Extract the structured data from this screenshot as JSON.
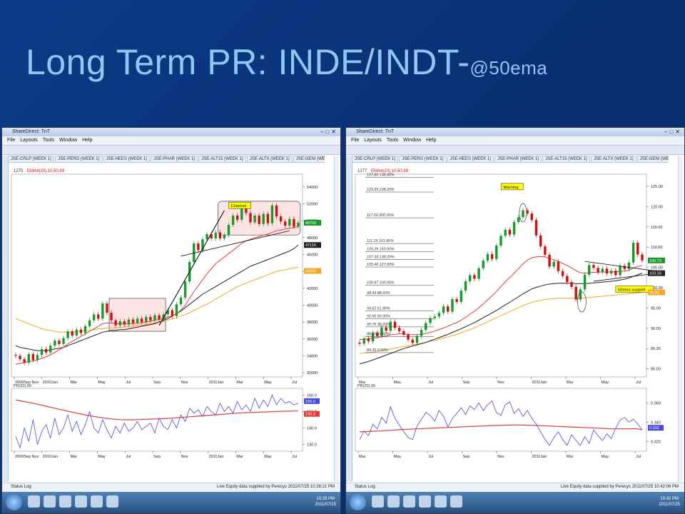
{
  "title": {
    "main": "Long Term PR: INDE/INDT-",
    "sub": "@50ema"
  },
  "left_window": {
    "window_title": "ShareDirect: TnT",
    "menu": [
      "File",
      "Layouts",
      "Tools",
      "Window",
      "Help"
    ],
    "tabs": [
      "JSE-CRLP (WEEK 1)",
      "JSE-PERG (WEEK 1)",
      "JSE-HEES (WEEK 1)",
      "JSE-PHAR (WEEK 1)",
      "JSE-ALT15 (WEEK 1)",
      "JSE-ALTX (WEEK 1)",
      "JSE-GENI (WEEK 1)",
      "JSE-ELEE (WEEK 1)",
      "JSE-INDE (WEEK 1)",
      "JSE-INDT (WEEK 1)",
      "JSE-SUPS (WEEK 1)",
      "JSE-"
    ],
    "active_tab": 8,
    "status_log": "Status Log",
    "live_text": "Live Equity data supplied by Peresys   2011/07/25 10:28:21 PM",
    "clock": "10:29 PM",
    "clock_date": "2011/07/25"
  },
  "right_window": {
    "window_title": "ShareDirect: TnT",
    "menu": [
      "File",
      "Layouts",
      "Tools",
      "Window",
      "Help"
    ],
    "tabs": [
      "JSE-CRLP (WEEK 1)",
      "JSE-PERG (WEEK 1)",
      "JSE-HEES (WEEK 1)",
      "JSE-PHAR (WEEK 1)",
      "JSE-ALT15 (WEEK 1)",
      "JSE-ALTX (WEEK 1)",
      "JSE-GENI (WEEK 1)",
      "JSE-ELEE (WEEK 1)",
      "JSE-INDE (WEEK 1)",
      "JSE-INDT (WEEK 1)",
      "JSE-SUPS (WEEK 1)",
      "JSE-"
    ],
    "active_tab": 9,
    "status_log": "Status Log",
    "live_text": "Live Equity data supplied by Peresys   2011/07/25 10:42:06 PM",
    "clock": "10:42 PM",
    "clock_date": "2011/07/25"
  },
  "colors": {
    "background": "#0a2f72",
    "title": "#8fc6f2",
    "bull": "#1a9a2a",
    "bear": "#d01010",
    "ema_green": "#2aa52a",
    "ema_red": "#e03a3a",
    "ema_black": "#222222",
    "ema_orange": "#f5a623",
    "pr_blue": "#4a4ad8",
    "pr_red": "#e03a3a",
    "box_fill": "#fde4e4",
    "label_yellow": "#ffff00"
  },
  "chart_data": [
    {
      "type": "candlestick",
      "instrument": "INDE",
      "header": "1275",
      "indicator_label": "EMA4(20),10,50,89",
      "y_ticks": [
        32000,
        34000,
        36000,
        38000,
        40000,
        42000,
        44000,
        46000,
        48000,
        50000,
        52000,
        54000
      ],
      "y_tick_labels": [
        "32000",
        "34000",
        "36000",
        "38000",
        "40000",
        "42000",
        "44000",
        "46000",
        "48000",
        "50000",
        "52000",
        "54000"
      ],
      "ylim": [
        31500,
        55500
      ],
      "x_labels": [
        "2009Sep Nov",
        "2010Jan",
        "Mar",
        "May",
        "Jul",
        "Sep",
        "Nov",
        "2011Jan",
        "Mar",
        "May",
        "Jul"
      ],
      "price_tags": [
        {
          "value": 49750,
          "text": "49750",
          "color": "#1a9a2a"
        },
        {
          "value": 47116,
          "text": "47116",
          "color": "#222222"
        },
        {
          "value": 44045,
          "text": "44045",
          "color": "#f5a623"
        }
      ],
      "annotations": [
        {
          "text": "Channel"
        }
      ],
      "close": [
        34000,
        33600,
        33200,
        34200,
        33500,
        34100,
        34800,
        34400,
        35200,
        35800,
        35400,
        36100,
        36900,
        36400,
        37100,
        36700,
        37500,
        38200,
        38900,
        38400,
        40200,
        39100,
        38200,
        37600,
        38100,
        37700,
        38300,
        37900,
        38400,
        38000,
        38600,
        38200,
        38800,
        38300,
        38900,
        39400,
        38700,
        40100,
        40900,
        42800,
        45100,
        47300,
        46500,
        47800,
        48400,
        47900,
        48600,
        47900,
        48300,
        49500,
        50600,
        50100,
        51400,
        50900,
        49800,
        50600,
        49600,
        50800,
        49700,
        51800,
        50500,
        49900,
        49400,
        50200,
        49300,
        49750
      ],
      "ema20": [
        33000,
        33100,
        33200,
        33300,
        33400,
        33500,
        33700,
        33900,
        34100,
        34400,
        34700,
        35000,
        35400,
        35700,
        36000,
        36300,
        36600,
        36900,
        37200,
        37500,
        37800,
        37900,
        37900,
        37800,
        37800,
        37800,
        37800,
        37800,
        37900,
        37900,
        38000,
        38100,
        38200,
        38300,
        38400,
        38600,
        38700,
        39000,
        39400,
        40000,
        40800,
        41600,
        42300,
        43000,
        43700,
        44300,
        44900,
        45300,
        45700,
        46100,
        46500,
        46900,
        47300,
        47600,
        47800,
        48000,
        48100,
        48300,
        48400,
        48600,
        48800,
        48900,
        49000,
        49100,
        49200,
        49300
      ],
      "ema89": [
        35200,
        35000,
        34900,
        34800,
        34700,
        34600,
        34600,
        34600,
        34700,
        34800,
        34900,
        35000,
        35200,
        35400,
        35600,
        35800,
        36000,
        36200,
        36400,
        36600,
        36800,
        36900,
        37000,
        37000,
        37100,
        37100,
        37200,
        37300,
        37400,
        37500,
        37600,
        37700,
        37800,
        38000,
        38200,
        38400,
        38700,
        39000,
        39300,
        39700,
        40100,
        40500,
        40900,
        41300,
        41600,
        41900,
        42200,
        42500,
        42800,
        43100,
        43400,
        43700,
        44000,
        44300,
        44600,
        44800,
        45000,
        45200,
        45400,
        45600,
        45800,
        46000,
        46200,
        46400,
        46700,
        47100
      ],
      "ema50": [
        38400,
        38200,
        38000,
        37800,
        37600,
        37400,
        37200,
        37100,
        37000,
        36900,
        36800,
        36800,
        36800,
        36800,
        36900,
        36900,
        37000,
        37000,
        37100,
        37200,
        37200,
        37300,
        37300,
        37300,
        37400,
        37400,
        37500,
        37500,
        37600,
        37600,
        37700,
        37800,
        37900,
        38000,
        38100,
        38200,
        38400,
        38500,
        38700,
        38900,
        39100,
        39400,
        39600,
        39900,
        40100,
        40400,
        40700,
        41000,
        41300,
        41600,
        41900,
        42200,
        42400,
        42600,
        42800,
        43000,
        43200,
        43400,
        43600,
        43800,
        44000,
        44100,
        44200,
        44300,
        44400,
        44500
      ],
      "pr_panel": {
        "label": "PR(20),89",
        "y_ticks": [
          130,
          140,
          150,
          160
        ],
        "y_tick_labels": [
          "130.0",
          "140.0",
          "150.0",
          "160.0"
        ],
        "ylim": [
          126,
          164
        ],
        "tags": [
          "155.0",
          "150.3"
        ],
        "pr": [
          135,
          128,
          140,
          132,
          145,
          130,
          138,
          142,
          134,
          146,
          136,
          140,
          148,
          138,
          144,
          136,
          142,
          150,
          140,
          137,
          145,
          139,
          134,
          141,
          137,
          143,
          138,
          140,
          144,
          139,
          141,
          143,
          137,
          146,
          141,
          139,
          145,
          140,
          148,
          144,
          152,
          149,
          151,
          147,
          153,
          150,
          148,
          155,
          150,
          153,
          149,
          156,
          151,
          154,
          150,
          158,
          152,
          157,
          153,
          160,
          154,
          158,
          155,
          156,
          154,
          155
        ],
        "signal": [
          157,
          156.5,
          156,
          155.5,
          155,
          154.4,
          153.8,
          153.2,
          152.6,
          152,
          151.4,
          150.8,
          150.2,
          149.6,
          149,
          148.5,
          148,
          147.5,
          147,
          146.6,
          146.2,
          145.8,
          145.5,
          145.3,
          145.1,
          145,
          145,
          145,
          145.1,
          145.2,
          145.3,
          145.4,
          145.5,
          145.6,
          145.7,
          145.8,
          146,
          146.2,
          146.4,
          146.6,
          146.8,
          147,
          147.2,
          147.4,
          147.6,
          147.8,
          148,
          148.2,
          148.4,
          148.6,
          148.8,
          149,
          149.2,
          149.3,
          149.4,
          149.5,
          149.6,
          149.7,
          149.8,
          149.9,
          150,
          150.1,
          150.2,
          150.2,
          150.3,
          150.3
        ]
      }
    },
    {
      "type": "candlestick",
      "instrument": "INDT",
      "header": "1277",
      "indicator_label": "EMA4(20),10,50,89",
      "y_ticks": [
        80,
        85,
        90,
        95,
        100,
        105,
        110,
        115,
        120,
        125
      ],
      "y_tick_labels": [
        "80.00",
        "85.00",
        "90.00",
        "95.00",
        "100.00",
        "105.00",
        "110.00",
        "115.00",
        "120.00",
        "125.00"
      ],
      "ylim": [
        78,
        128
      ],
      "x_labels": [
        "Mar",
        "May",
        "Jul",
        "Sep",
        "Nov",
        "2011Jan",
        "Mar",
        "May",
        "Jul"
      ],
      "price_tags": [
        {
          "value": 106.73,
          "text": "106.73",
          "color": "#1a9a2a"
        },
        {
          "value": 103.59,
          "text": "103.59",
          "color": "#222222"
        },
        {
          "value": 98.85,
          "text": "98.85",
          "color": "#f5a623"
        }
      ],
      "fib_levels": [
        "127.60 138.40%",
        "123.95 238.20%",
        "117.60 200.00%",
        "111.25 161.80%",
        "109.29 150.00%",
        "107.33 138.20%",
        "105.46 127.00%",
        "100.97 100.00%",
        "98.43 88.60%",
        "94.62 61.80%",
        "92.66 50.00%",
        "90.70 38.20%",
        "88.27 23.60%",
        "84.35 0.00%"
      ],
      "annotations": [
        {
          "text": "Warning"
        },
        {
          "text": "50ema support"
        }
      ],
      "close": [
        86.2,
        87.5,
        86.8,
        88.9,
        88.1,
        90.2,
        89.4,
        91.6,
        90.1,
        89.3,
        88.4,
        87.2,
        86.4,
        88.1,
        89.6,
        91.3,
        92.5,
        92.9,
        93.8,
        95.4,
        94.1,
        97.2,
        96.5,
        99.3,
        101.6,
        103.1,
        102.2,
        104.8,
        106.7,
        108.3,
        107.1,
        110.4,
        112.8,
        114.3,
        113.1,
        116.2,
        117.4,
        119.1,
        118.3,
        116.7,
        112.9,
        110.2,
        108.1,
        105.2,
        106.4,
        104.1,
        102.9,
        101.4,
        100.2,
        97.1,
        99.6,
        103.2,
        105.6,
        104.9,
        103.8,
        104.7,
        103.5,
        104.2,
        103.1,
        105.4,
        104.6,
        106.2,
        111.1,
        108.2,
        106.73
      ],
      "ema20": [
        87.2,
        87.3,
        87.4,
        87.6,
        87.7,
        87.9,
        88.1,
        88.4,
        88.5,
        88.6,
        88.6,
        88.5,
        88.4,
        88.4,
        88.5,
        88.7,
        89,
        89.3,
        89.7,
        90.1,
        90.5,
        91,
        91.4,
        92,
        92.7,
        93.5,
        94.2,
        95.1,
        96,
        97,
        98,
        99.1,
        100.3,
        101.5,
        102.5,
        103.6,
        104.7,
        105.9,
        106.8,
        107.4,
        107.6,
        107.7,
        107.6,
        107.2,
        106.9,
        106.5,
        106,
        105.5,
        104.9,
        104.2,
        103.7,
        103.6,
        103.7,
        103.8,
        103.8,
        103.9,
        103.9,
        103.9,
        103.9,
        104,
        104.1,
        104.3,
        104.9,
        105.2,
        105.5
      ],
      "ema89": [
        81.2,
        81.5,
        81.8,
        82.2,
        82.6,
        83,
        83.4,
        83.8,
        84.2,
        84.6,
        85,
        85.3,
        85.6,
        85.9,
        86.2,
        86.5,
        86.9,
        87.3,
        87.7,
        88.1,
        88.5,
        89,
        89.4,
        89.9,
        90.4,
        90.9,
        91.4,
        92,
        92.6,
        93.2,
        93.8,
        94.4,
        95.1,
        95.8,
        96.4,
        97.1,
        97.8,
        98.5,
        99.1,
        99.7,
        100.1,
        100.4,
        100.7,
        100.9,
        101,
        101.1,
        101.1,
        101.1,
        101.1,
        101,
        101,
        101,
        101.1,
        101.2,
        101.3,
        101.4,
        101.5,
        101.6,
        101.7,
        101.9,
        102.1,
        102.4,
        102.8,
        103.2,
        103.59
      ],
      "ema50": [
        83.8,
        83.9,
        84,
        84.1,
        84.3,
        84.5,
        84.7,
        84.9,
        85.1,
        85.3,
        85.5,
        85.7,
        85.9,
        86.1,
        86.3,
        86.5,
        86.8,
        87,
        87.3,
        87.6,
        87.9,
        88.2,
        88.5,
        88.9,
        89.3,
        89.7,
        90.1,
        90.6,
        91.1,
        91.6,
        92.1,
        92.6,
        93.1,
        93.6,
        94.1,
        94.6,
        95.1,
        95.6,
        96,
        96.4,
        96.7,
        96.9,
        97.1,
        97.2,
        97.3,
        97.4,
        97.4,
        97.4,
        97.4,
        97.4,
        97.4,
        97.5,
        97.6,
        97.7,
        97.8,
        97.9,
        98,
        98.1,
        98.2,
        98.3,
        98.4,
        98.5,
        98.6,
        98.7,
        98.85
      ],
      "pr_panel": {
        "label": "PR(20),89",
        "y_ticks": [
          0.32,
          0.34,
          0.36
        ],
        "y_tick_labels": [
          "0.320",
          "0.340",
          "0.360"
        ],
        "ylim": [
          0.31,
          0.375
        ],
        "tags": [
          "0.332"
        ],
        "pr": [
          0.322,
          0.331,
          0.326,
          0.338,
          0.333,
          0.345,
          0.339,
          0.356,
          0.344,
          0.337,
          0.33,
          0.324,
          0.322,
          0.336,
          0.343,
          0.35,
          0.347,
          0.341,
          0.352,
          0.346,
          0.335,
          0.344,
          0.349,
          0.355,
          0.348,
          0.357,
          0.353,
          0.36,
          0.352,
          0.358,
          0.362,
          0.35,
          0.347,
          0.358,
          0.361,
          0.349,
          0.354,
          0.346,
          0.352,
          0.344,
          0.338,
          0.33,
          0.322,
          0.316,
          0.324,
          0.33,
          0.322,
          0.316,
          0.327,
          0.321,
          0.316,
          0.325,
          0.318,
          0.332,
          0.326,
          0.321,
          0.328,
          0.323,
          0.334,
          0.342,
          0.345,
          0.34,
          0.343,
          0.338,
          0.332
        ],
        "signal": [
          0.33,
          0.3302,
          0.3304,
          0.3306,
          0.3308,
          0.331,
          0.3313,
          0.3316,
          0.3319,
          0.3322,
          0.3325,
          0.3327,
          0.3329,
          0.3331,
          0.3333,
          0.3335,
          0.3337,
          0.3339,
          0.3341,
          0.3343,
          0.3345,
          0.3347,
          0.3349,
          0.3351,
          0.3353,
          0.3355,
          0.3357,
          0.3359,
          0.3361,
          0.3363,
          0.3365,
          0.3367,
          0.3368,
          0.3369,
          0.337,
          0.3371,
          0.3371,
          0.337,
          0.3369,
          0.3368,
          0.3366,
          0.3364,
          0.3362,
          0.336,
          0.3358,
          0.3356,
          0.3354,
          0.3352,
          0.335,
          0.3348,
          0.3346,
          0.3344,
          0.3342,
          0.334,
          0.3338,
          0.3336,
          0.3334,
          0.3332,
          0.3331,
          0.3331,
          0.3331,
          0.3331,
          0.3332,
          0.3332,
          0.332
        ]
      }
    }
  ]
}
